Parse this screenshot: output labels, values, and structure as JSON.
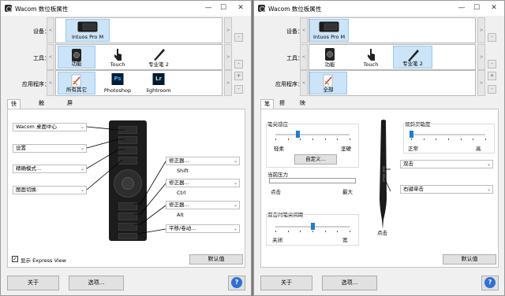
{
  "left_window": {
    "title": "Wacom 数位板属性",
    "labels": {
      "device": "设备：",
      "tool": "工具：",
      "app": "应用程序："
    },
    "device": {
      "name": "Intuos Pro M"
    },
    "tools": [
      {
        "label": "功能",
        "icon": "function-icon",
        "selected": true
      },
      {
        "label": "Touch",
        "icon": "touch-icon",
        "selected": false
      },
      {
        "label": "专业笔 2",
        "icon": "pen-icon",
        "selected": false
      }
    ],
    "apps": [
      {
        "label": "所有其它",
        "icon": "all-apps-icon",
        "selected": true
      },
      {
        "label": "Photoshop",
        "icon": "photoshop-icon",
        "abbr": "Ps",
        "selected": false
      },
      {
        "label": "lightroom",
        "icon": "lightroom-icon",
        "abbr": "Lr",
        "selected": false
      }
    ],
    "tabs": [
      "快捷键",
      "触控环",
      "屏幕控制"
    ],
    "left_dropdowns": [
      "Wacom 桌面中心",
      "设置",
      "精确模式...",
      "图面切换"
    ],
    "right_dropdowns": [
      "修正器...",
      "修正器...",
      "修正器...",
      "平移/卷动..."
    ],
    "modifier_labels": [
      "Shift",
      "Ctrl",
      "Alt"
    ],
    "express_view": {
      "label": "显示 Express View",
      "checked": true
    },
    "default_button": "默认值",
    "about_button": "关于",
    "options_button": "选项...",
    "help": "?"
  },
  "right_window": {
    "title": "Wacom 数位板属性",
    "labels": {
      "device": "设备：",
      "tool": "工具：",
      "app": "应用程序："
    },
    "device": {
      "name": "Intuos Pro M"
    },
    "tools": [
      {
        "label": "功能",
        "icon": "function-icon",
        "selected": false
      },
      {
        "label": "Touch",
        "icon": "touch-icon",
        "selected": false
      },
      {
        "label": "专业笔 2",
        "icon": "pen-icon",
        "selected": true
      }
    ],
    "apps": [
      {
        "label": "全部",
        "icon": "all-apps-icon",
        "selected": true
      }
    ],
    "tabs": [
      "笔",
      "擦除",
      "映射"
    ],
    "tip_feel": {
      "title": "笔尖感应",
      "left": "轻柔",
      "right": "坚硬",
      "value": 0.3,
      "custom_button": "自定义..."
    },
    "current_pressure": {
      "title": "当前压力",
      "left": "点击",
      "right": "最大"
    },
    "double_click": {
      "title": "双击时笔尖间距",
      "left": "关闭",
      "right": "宽",
      "value": 0.5
    },
    "tilt": {
      "title": "倾斜灵敏度",
      "left": "正常",
      "right": "高",
      "value": 0.0
    },
    "pen_buttons": [
      "双击",
      "右键单击"
    ],
    "tip_label": "点击",
    "default_button": "默认值",
    "about_button": "关于",
    "options_button": "选项...",
    "help": "?"
  },
  "window_controls": {
    "minimize": "—",
    "maximize": "☐",
    "close": "✕"
  },
  "colors": {
    "selection": "#cce4f7",
    "accent": "#1a7fd9",
    "help": "#2f6fd6",
    "photoshop": "#001e36",
    "photoshop_text": "#31a8ff",
    "lightroom": "#001a2e",
    "lightroom_text": "#add5ec"
  }
}
